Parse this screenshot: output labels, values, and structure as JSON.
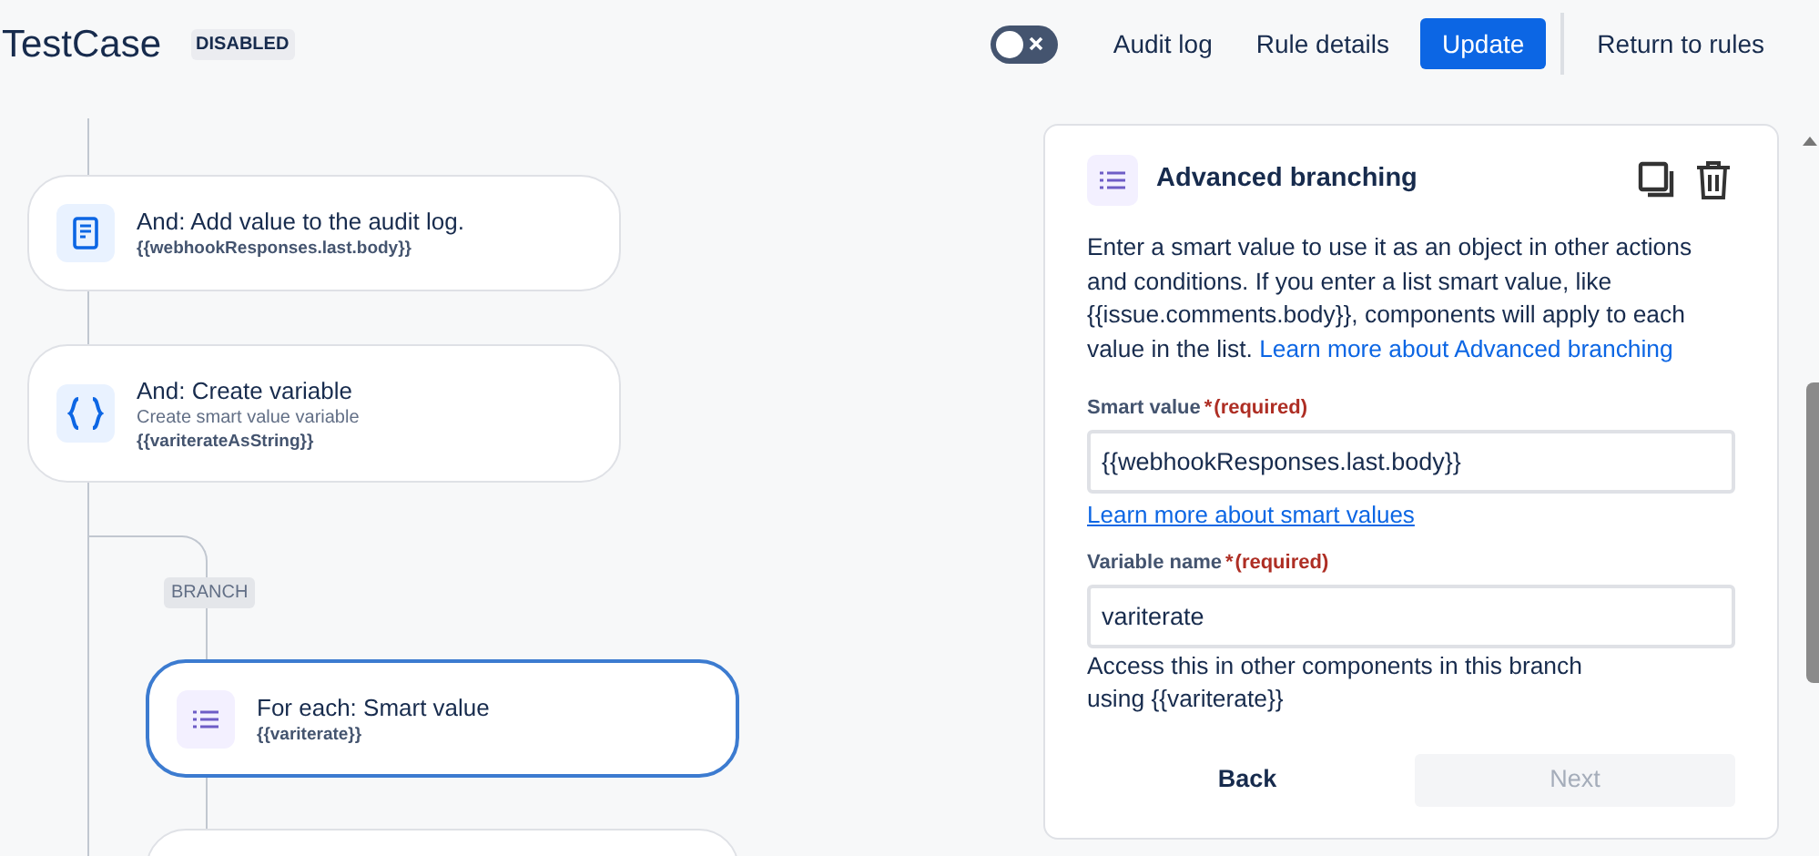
{
  "header": {
    "title": "TestCase",
    "status_badge": "DISABLED",
    "rule_enabled": false,
    "links": [
      "Audit log",
      "Rule details"
    ],
    "primary_button": "Update",
    "return_button": "Return to rules"
  },
  "flow": {
    "nodes": [
      {
        "kind": "log",
        "title": "And: Add value to the audit log.",
        "detail": "{{webhookResponses.last.body}}",
        "selected": false
      },
      {
        "kind": "variable",
        "title": "And: Create variable",
        "subtitle": "Create smart value variable",
        "detail": "{{variterateAsString}}",
        "selected": false
      },
      {
        "kind": "branch",
        "title": "For each: Smart value",
        "detail": "{{variterate}}",
        "selected": true
      },
      {
        "kind": "blank",
        "selected": false
      }
    ],
    "branch_label": "BRANCH"
  },
  "panel": {
    "title": "Advanced branching",
    "description": "Enter a smart value to use it as an object in other actions and conditions. If you enter a list smart value, like {{issue.comments.body}}, components will apply to each value in the list.",
    "description_link": "Learn more about Advanced branching",
    "fields": [
      {
        "label": "Smart value",
        "required_mark": "*",
        "required_note": "(required)",
        "value": "{{webhookResponses.last.body}}",
        "link": "Learn more about smart values"
      },
      {
        "label": "Variable name",
        "required_mark": "*",
        "required_note": "(required)",
        "value": "variterate",
        "help": "Access this in other components in this branch using {{variterate}}"
      }
    ],
    "buttons": [
      {
        "label": "Back",
        "disabled": false
      },
      {
        "label": "Next",
        "disabled": true
      }
    ]
  }
}
